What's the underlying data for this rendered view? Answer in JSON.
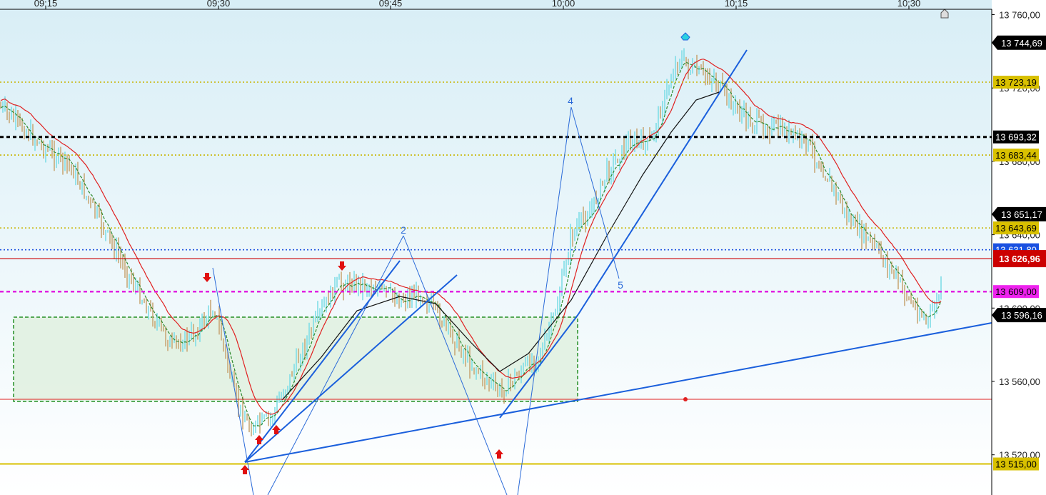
{
  "chart_data": {
    "type": "candlestick",
    "symbol_scale": "price",
    "x_ticks": [
      "09:15",
      "09:30",
      "09:45",
      "10:00",
      "10:15",
      "10:30"
    ],
    "y_ticks": [
      "13 760,00",
      "13 720,00",
      "13 680,00",
      "13 640,00",
      "13 600,00",
      "13 560,00",
      "13 520,00"
    ],
    "ylim": [
      13500,
      13770
    ],
    "grid": false,
    "colors": {
      "background_top": "#d8eef6",
      "background_bottom": "#ffffff",
      "up_bar": "#7fdde6",
      "down_bar": "#c8a878",
      "ma_fast": "#2e8b2e",
      "ma_slow": "#e02020",
      "ma_long": "#111111",
      "trendline": "#1a5fdc",
      "wave": "#2a6ad8",
      "zone_fill": "#e3f2e3",
      "zone_border": "#1a8a1a"
    },
    "horizontal_levels": [
      {
        "label": "13 744,69",
        "value": 13744.69,
        "style": "tag",
        "tag_bg": "#000000",
        "tag_fg": "#ffffff"
      },
      {
        "label": "13 723,19",
        "value": 13723.19,
        "style": "dotted",
        "color": "#c8b400",
        "tag_bg": "#d8c000",
        "tag_fg": "#000000"
      },
      {
        "label": "13 693,32",
        "value": 13693.32,
        "style": "dashed-thick",
        "color": "#000000",
        "tag_bg": "#000000",
        "tag_fg": "#ffffff"
      },
      {
        "label": "13 683,44",
        "value": 13683.44,
        "style": "dotted",
        "color": "#c8b400",
        "tag_bg": "#d8c000",
        "tag_fg": "#000000"
      },
      {
        "label": "13 651,17",
        "value": 13651.17,
        "style": "tag",
        "tag_bg": "#000000",
        "tag_fg": "#ffffff"
      },
      {
        "label": "13 643,69",
        "value": 13643.69,
        "style": "dotted",
        "color": "#c8b400",
        "tag_bg": "#d8c000",
        "tag_fg": "#000000"
      },
      {
        "label": "13 631,80",
        "value": 13631.8,
        "style": "dotted-blue",
        "color": "#1a50e0",
        "tag_bg": "#1a50e0",
        "tag_fg": "#ffffff"
      },
      {
        "label": "13 626,96",
        "value": 13626.96,
        "style": "solid",
        "color": "#cc0000",
        "tag_bg": "#cc0000",
        "tag_fg": "#ffffff"
      },
      {
        "label": "13 609,00",
        "value": 13609.0,
        "style": "dashed-magenta",
        "color": "#e020e0",
        "tag_bg": "#ee22ee",
        "tag_fg": "#000000"
      },
      {
        "label": "13 596,16",
        "value": 13596.16,
        "style": "tag",
        "tag_bg": "#000000",
        "tag_fg": "#ffffff"
      },
      {
        "label": "13 515,00",
        "value": 13515.0,
        "style": "solid",
        "color": "#d8c000",
        "tag_bg": "#d8c000",
        "tag_fg": "#000000"
      }
    ],
    "wave_labels": [
      "2",
      "4",
      "5"
    ],
    "markers": [
      "down-arrow",
      "down-arrow",
      "up-arrow",
      "up-arrow",
      "up-arrow",
      "up-arrow",
      "pin"
    ],
    "alert_icon": "bell-icon"
  }
}
